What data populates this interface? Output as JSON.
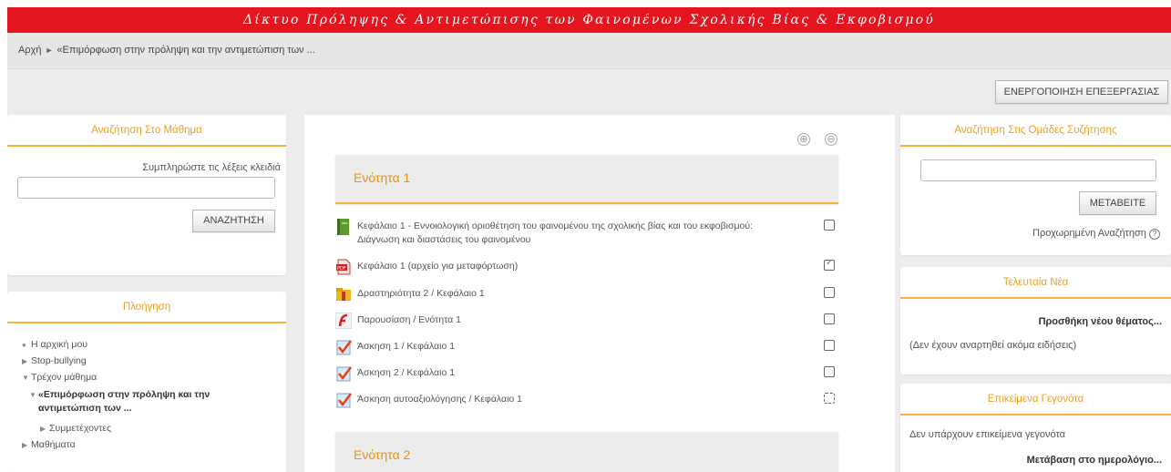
{
  "header": {
    "banner_title": "Δίκτυο Πρόληψης & Αντιμετώπισης των Φαινομένων Σχολικής Βίας & Εκφοβισμού",
    "banner_color": "#e4151f"
  },
  "breadcrumb": {
    "home": "Αρχή",
    "separator": "►",
    "current": "«Επιμόρφωση στην πρόληψη και την αντιμετώπιση των ..."
  },
  "toolbar": {
    "edit_button": "ΕΝΕΡΓΟΠΟΙΗΣΗ ΕΠΕΞΕΡΓΑΣΙΑΣ"
  },
  "course_search": {
    "title": "Αναζήτηση Στο Μάθημα",
    "label": "Συμπληρώστε τις λέξεις κλειδιά",
    "value": "",
    "button": "ΑΝΑΖΗΤΗΣΗ"
  },
  "navigation": {
    "title": "Πλοήγηση",
    "items": [
      {
        "marker": "●",
        "label": "Η αρχική μου"
      },
      {
        "marker": "▶",
        "label": "Stop-bullying"
      },
      {
        "marker": "▼",
        "label": "Τρέχον μάθημα"
      },
      {
        "marker": "▼",
        "label": "«Επιμόρφωση στην πρόληψη και την",
        "label2": "αντιμετώπιση των ..."
      },
      {
        "marker": "▶",
        "label": "Συμμετέχοντες"
      },
      {
        "marker": "▶",
        "label": "Μαθήματα"
      }
    ]
  },
  "course": {
    "sections": [
      {
        "title": "Ενότητα 1",
        "activities": [
          {
            "icon": "book-icon",
            "label": "Κεφάλαιο 1 - Εννοιολογική οριοθέτηση του φαινομένου της σχολικής βίας και του εκφοβισμού:",
            "label2": "Διάγνωση και διαστάσεις του φαινομένου",
            "completion": "unchecked"
          },
          {
            "icon": "pdf-file-icon",
            "label": "Κεφάλαιο 1 (αρχείο για μεταφόρτωση)",
            "completion": "checked"
          },
          {
            "icon": "folder-icon",
            "label": "Δραστηριότητα 2 / Κεφάλαιο 1",
            "completion": "unchecked"
          },
          {
            "icon": "flash-icon",
            "label": "Παρουσίαση / Ενότητα 1",
            "completion": "unchecked"
          },
          {
            "icon": "quiz-icon",
            "label": "Άσκηση 1 / Κεφάλαιο 1",
            "completion": "unchecked"
          },
          {
            "icon": "quiz-icon",
            "label": "Άσκηση 2 / Κεφάλαιο 1",
            "completion": "unchecked"
          },
          {
            "icon": "quiz-icon",
            "label": "Άσκηση αυτοαξιολόγησης / Κεφάλαιο 1",
            "completion": "dashed"
          }
        ]
      },
      {
        "title": "Ενότητα 2",
        "activities": []
      }
    ],
    "expand_all": "⊕",
    "collapse_all": "⊖"
  },
  "forum_search": {
    "title": "Αναζήτηση Στις Ομάδες Συζήτησης",
    "value": "",
    "button": "ΜΕΤΑΒΕΙΤΕ",
    "advanced_link": "Προχωρημένη Αναζήτηση"
  },
  "latest_news": {
    "title": "Τελευταία Νέα",
    "add_topic": "Προσθήκη νέου θέματος...",
    "empty": "(Δεν έχουν αναρτηθεί ακόμα ειδήσεις)"
  },
  "upcoming_events": {
    "title": "Επικείμενα Γεγονότα",
    "empty": "Δεν υπάρχουν επικείμενα γεγονότα",
    "calendar_link": "Μετάβαση στο ημερολόγιο..."
  },
  "colors": {
    "accent": "#f5b23c",
    "heading": "#f0a020",
    "background": "#ececec"
  }
}
